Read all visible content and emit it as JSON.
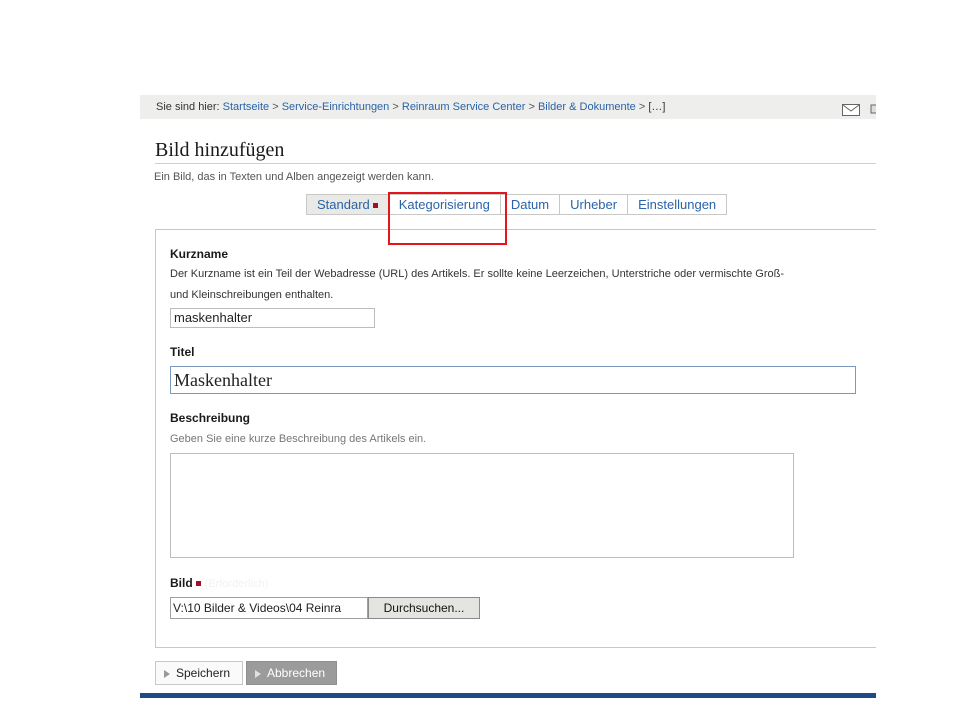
{
  "breadcrumb": {
    "prefix": "Sie sind hier:",
    "items": [
      "Startseite",
      "Service-Einrichtungen",
      "Reinraum Service Center",
      "Bilder & Dokumente",
      "[…]"
    ],
    "separator": ">",
    "icons": [
      "mail-icon",
      "print-icon"
    ]
  },
  "page": {
    "title": "Bild hinzufügen",
    "description": "Ein Bild, das in Texten und Alben angezeigt werden kann."
  },
  "tabs": [
    {
      "label": "Standard",
      "required": true,
      "active": true
    },
    {
      "label": "Kategorisierung",
      "active": false
    },
    {
      "label": "Datum",
      "active": false
    },
    {
      "label": "Urheber",
      "active": false
    },
    {
      "label": "Einstellungen",
      "active": false
    }
  ],
  "form": {
    "kurzname": {
      "label": "Kurzname",
      "help_line1": "Der Kurzname ist ein Teil der Webadresse (URL) des Artikels. Er sollte keine Leerzeichen, Unterstriche oder vermischte Groß-",
      "help_line2": "und Kleinschreibungen enthalten.",
      "value": "maskenhalter"
    },
    "titel": {
      "label": "Titel",
      "value": "Maskenhalter"
    },
    "beschreibung": {
      "label": "Beschreibung",
      "help": "Geben Sie eine kurze Beschreibung des Artikels ein.",
      "value": ""
    },
    "bild": {
      "label": "Bild",
      "required_text": "(Erforderlich)",
      "file_value": "V:\\10 Bilder & Videos\\04 Reinra",
      "browse_label": "Durchsuchen..."
    }
  },
  "actions": {
    "save_label": "Speichern",
    "cancel_label": "Abbrechen"
  },
  "colors": {
    "link": "#2a63a8",
    "required": "#a0102a",
    "highlight": "#e3161b",
    "bottom_bar": "#1e4b86"
  }
}
